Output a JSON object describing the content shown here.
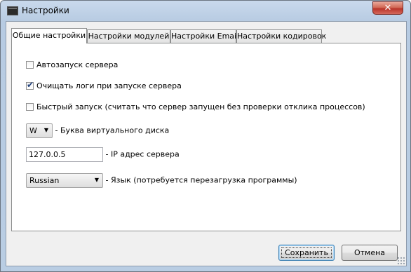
{
  "window": {
    "title": "Настройки",
    "close_label": "✕"
  },
  "tabs": [
    {
      "label": "Общие настройки",
      "active": true
    },
    {
      "label": "Настройки модулей",
      "active": false
    },
    {
      "label": "Настройки Email",
      "active": false
    },
    {
      "label": "Настройки кодировок",
      "active": false
    }
  ],
  "general": {
    "autostart": {
      "label": "Автозапуск сервера",
      "checked": false
    },
    "clear_logs": {
      "label": "Очищать логи при запуске сервера",
      "checked": true
    },
    "fast_start": {
      "label": "Быстрый запуск  (считать что сервер запущен без проверки отклика процессов)",
      "checked": false
    },
    "drive": {
      "value": "W",
      "label": "- Буква виртуального диска"
    },
    "ip": {
      "value": "127.0.0.5",
      "label": "- IP адрес сервера"
    },
    "language": {
      "value": "Russian",
      "label": "- Язык (потребуется перезагрузка программы)"
    }
  },
  "buttons": {
    "save": "Сохранить",
    "cancel": "Отмена"
  },
  "icons": {
    "checkmark": "✔",
    "dropdown_arrow": "▼"
  }
}
